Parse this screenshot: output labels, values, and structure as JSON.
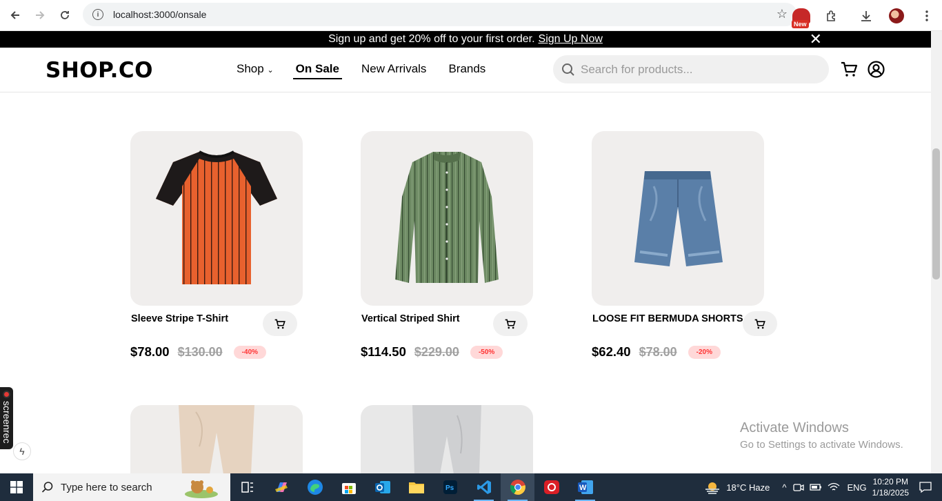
{
  "browser": {
    "url": "localhost:3000/onsale",
    "new_badge": "New"
  },
  "promo": {
    "text": "Sign up and get 20% off to your first order.",
    "link": "Sign Up Now"
  },
  "header": {
    "logo": "SHOP.CO",
    "nav": [
      "Shop",
      "On Sale",
      "New Arrivals",
      "Brands"
    ],
    "active_nav": "On Sale",
    "search_placeholder": "Search for products..."
  },
  "products": [
    {
      "name": "Sleeve Stripe T-Shirt",
      "price": "$78.00",
      "original_price": "$130.00",
      "discount": "-40%"
    },
    {
      "name": "Vertical Striped Shirt",
      "price": "$114.50",
      "original_price": "$229.00",
      "discount": "-50%"
    },
    {
      "name": "LOOSE FIT BERMUDA SHORTS",
      "price": "$62.40",
      "original_price": "$78.00",
      "discount": "-20%"
    }
  ],
  "colors": {
    "accent": "#000000",
    "discount_text": "#ff3333",
    "discount_bg": "#ffd8d8",
    "card_bg": "#f0eeed"
  },
  "watermark": {
    "line1": "Activate Windows",
    "line2": "Go to Settings to activate Windows."
  },
  "screenrec": "screenrec",
  "taskbar": {
    "search_placeholder": "Type here to search",
    "weather": "18°C  Haze",
    "language": "ENG",
    "time": "10:20 PM",
    "date": "1/18/2025"
  }
}
